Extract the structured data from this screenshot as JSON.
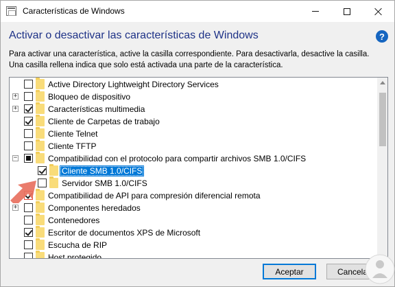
{
  "window": {
    "title": "Características de Windows",
    "icon": "windows-features-icon",
    "controls": {
      "minimize": "minimize-icon",
      "maximize": "maximize-icon",
      "close": "close-icon"
    }
  },
  "heading": "Activar o desactivar las características de Windows",
  "help_icon": "help-icon",
  "description": {
    "line1": "Para activar una característica, active la casilla correspondiente. Para desactivarla, desactive la casilla.",
    "line2": "Una casilla rellena indica que solo está activada una parte de la característica."
  },
  "features": [
    {
      "label": "Active Directory Lightweight Directory Services",
      "state": "unchecked",
      "expander": ""
    },
    {
      "label": "Bloqueo de dispositivo",
      "state": "unchecked",
      "expander": "+"
    },
    {
      "label": "Características multimedia",
      "state": "checked",
      "expander": "+"
    },
    {
      "label": "Cliente de Carpetas de trabajo",
      "state": "checked",
      "expander": ""
    },
    {
      "label": "Cliente Telnet",
      "state": "unchecked",
      "expander": ""
    },
    {
      "label": "Cliente TFTP",
      "state": "unchecked",
      "expander": ""
    },
    {
      "label": "Compatibilidad con el protocolo para compartir archivos SMB 1.0/CIFS",
      "state": "partial",
      "expander": "−"
    },
    {
      "label": "Cliente SMB 1.0/CIFS",
      "state": "checked",
      "expander": "",
      "selected": true
    },
    {
      "label": "Servidor SMB 1.0/CIFS",
      "state": "unchecked",
      "expander": ""
    },
    {
      "label": "Compatibilidad de API para compresión diferencial remota",
      "state": "checked",
      "expander": ""
    },
    {
      "label": "Componentes heredados",
      "state": "unchecked",
      "expander": "+"
    },
    {
      "label": "Contenedores",
      "state": "unchecked",
      "expander": ""
    },
    {
      "label": "Escritor de documentos XPS de Microsoft",
      "state": "checked",
      "expander": ""
    },
    {
      "label": "Escucha de RIP",
      "state": "unchecked",
      "expander": ""
    },
    {
      "label": "Host protegido",
      "state": "unchecked",
      "expander": ""
    }
  ],
  "buttons": {
    "accept": "Aceptar",
    "cancel": "Cancelar"
  },
  "colors": {
    "heading": "#1e3287",
    "selection": "#0078d7",
    "annotation_arrow": "#e4473b"
  }
}
